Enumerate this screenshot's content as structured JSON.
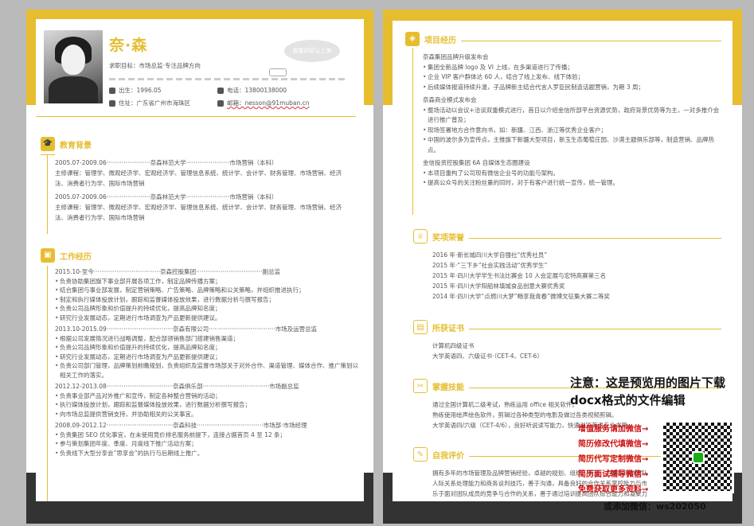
{
  "left": {
    "name": "奈·森",
    "target": "求职目标：市场总监·专注品牌方向",
    "bubble": "我要好好认上美",
    "birth": "出生：1996.05",
    "phone": "电话：13800138000",
    "addr": "住址：广东省广州市海珠区",
    "email": "邮箱：nesson@91muban.cn",
    "edu_title": "教育背景",
    "edu": [
      {
        "head": "2005.07-2009.06·······················奈森林范大学·······················市场营销（本科）",
        "body": "主修课程：管理学、微观经济学、宏观经济学、管理信息系统、统计学、会计学、财务管理、市场营销、经济法、消费者行为学、国际市场营销"
      },
      {
        "head": "2005.07-2009.06·······················奈森林范大学·······················市场营销（本科）",
        "body": "主修课程：管理学、微观经济学、宏观经济学、管理信息系统、统计学、会计学、财务管理、市场营销、经济法、消费者行为学、国际市场营销"
      }
    ],
    "work_title": "工作经历",
    "work": [
      {
        "head": "2015.10-至今···································奈森控股集团···································副总监",
        "items": [
          "负责协助集团旗下事业部开展各项工作，制定品牌传播方案；",
          "结合集团与事业部发展，制定营销策略、广告策略、品牌策略和公关策略，并组织推进执行；",
          "制定和执行媒体投放计划，跟踪和监督媒体投放效果，进行数据分析与撰写报告；",
          "负责公司品牌形象和价值提升的持续优化，提高品牌知名度；",
          "研究行业发展动态，定期进行市场调查为产品更新提供建议。"
        ]
      },
      {
        "head": "2013.10-2015.09···································奈森有限公司···································市场及运营总监",
        "items": [
          "根据公司发展情况进行战略调整，配合部领销售部门搭建销售渠道；",
          "负责公司品牌形象和价值提升的持续优化，提高品牌知名度；",
          "研究行业发展动态，定期进行市场调查为产品更新提供建议；",
          "负责公司部门管理，品牌策划前瞻规划，负责组织及监督市场部关于对外合作、渠道管理、媒体合作、推广策划以相关工作的落实。"
        ]
      },
      {
        "head": "2012.12-2013.08···································奈森俱乐部···································市场副总监",
        "items": [
          "负责事业部产品对外推广和宣传，制定各种整合营销的活动；",
          "执行媒体投放计划，跟踪和监督媒体投放效果，进行数据分析撰写报告；",
          "向市场总监提供营销支持，并协助相关的公关事宜。"
        ]
      },
      {
        "head": "2008.09-2012.12···································奈森科技···································市场部·市场经理",
        "items": [
          "负责集团 SEO 优化事宜，在未使用竞价排名服务前提下，连接占据首页 4 至 12 条；",
          "参与策划集团年度、季度、月度线下推广活动方案；",
          "负责线下大型分享会”思享会”的执行与后期线上推广。"
        ]
      }
    ]
  },
  "right": {
    "proj_title": "项目经历",
    "proj": [
      {
        "head": "奈森集团品牌升级发布会",
        "items": [
          "集团全新品牌 logo 及 VI 上线，在多渠道进行了传播；",
          "企业 VIP 客户群体达 60 人，结合了线上发布、线下体验；",
          "后续媒体报道持续升温，子品牌新主结合代言人罗臣民制造话题营销，为期 3 周；"
        ]
      },
      {
        "head": "奈森商业模式发布会",
        "items": [
          "整场活动以会议+洽谈双重模式进行，首日以介绍金信所部平台资源优势，政府背景优势等为主，一对多推介会进行推广普及；",
          "现场签署地方合作意向书，如：新疆、江西、浙江等优秀企业客户；",
          "中国的波尔多为宣传点，主推旗下新疆大型项目，新玉生态葡萄庄园、沙漠主题俱乐部等，制造营销、品牌热点。"
        ]
      },
      {
        "head": "金信投资控股集团 6A 自媒体生态圈建设",
        "items": [
          "本项目重构了公司现有微信企业号的功能与架构。",
          "提高公众号的关注粉丝量的同时，对于有客户进行统一宣传，统一管理。"
        ]
      }
    ],
    "award_title": "奖项荣誉",
    "awards": [
      "2016 年·新长城四川大学自强社“优秀社员”",
      "2015 年·“三下乡”社会实践活动“优秀学生”",
      "2015 年·四川大学学生书法比赛会 10 人会定展与宏特高赛第三名",
      "2015 年·四川大学阳船林填城食品创意大赛优秀奖",
      "2014 年·四川大学“点燃川大梦”畅享我青春”微博文征集大赛二等奖"
    ],
    "cert_title": "所获证书",
    "certs": [
      "计算机四级证书",
      "大学英语四、六级证书·（CET-4、CET-6）"
    ],
    "skill_title": "掌握技能",
    "skills": [
      "通过全国计算机二级考试，熟练运用 office 相关软件。",
      "熟练使用绘声绘色软件，剪辑过各种类型的电影及做过各类视频剪辑。",
      "大学英语四/六级（CET-4/6），良好听说读写能力，快速浏览英语专业书籍。"
    ],
    "eval_title": "自我评价",
    "eval": [
      "拥有多年的市场管理及品牌营销经验，卓越的规划、组织、策划、方案执行和团队领导能力，积累较强的",
      "人际关系处理能力和商务谈判技巧，善于沟通，具备良好的合作关系掌控能力与市场开拓能力；敢于",
      "乐于面对团队成员的竞争与合作的关系，善于通过培训提高团队综合能力和凝聚力。"
    ]
  },
  "overlay": {
    "notice": "注意：这是预览用的图片下载docx格式的文件编辑",
    "promo": [
      "增值服务请加微信→",
      "简历修改代填微信→",
      "简历代写定制微信→",
      "简历面试辅导微信→",
      "免费获取更多资料→"
    ],
    "wechat": "或添加微信：ws202050"
  }
}
